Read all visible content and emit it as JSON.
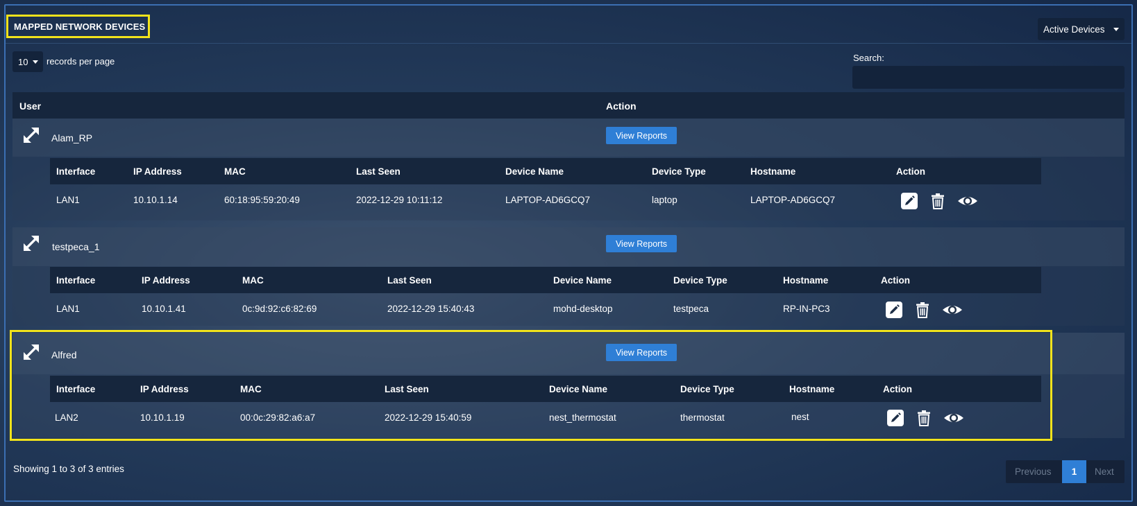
{
  "header": {
    "title": "MAPPED NETWORK DEVICES",
    "filter_value": "Active Devices"
  },
  "controls": {
    "records_per_page": "10",
    "records_label": "records per page",
    "search_label": "Search:",
    "search_value": ""
  },
  "table": {
    "col_user": "User",
    "col_action": "Action",
    "sub_columns": [
      "Interface",
      "IP Address",
      "MAC",
      "Last Seen",
      "Device Name",
      "Device Type",
      "Hostname",
      "Action"
    ],
    "view_reports_label": "View Reports",
    "groups": [
      {
        "user": "Alam_RP",
        "device": {
          "interface": "LAN1",
          "ip": "10.10.1.14",
          "mac": "60:18:95:59:20:49",
          "last_seen": "2022-12-29 10:11:12",
          "device_name": "LAPTOP-AD6GCQ7",
          "device_type": "laptop",
          "hostname": "LAPTOP-AD6GCQ7"
        }
      },
      {
        "user": "testpeca_1",
        "device": {
          "interface": "LAN1",
          "ip": "10.10.1.41",
          "mac": "0c:9d:92:c6:82:69",
          "last_seen": "2022-12-29 15:40:43",
          "device_name": "mohd-desktop",
          "device_type": "testpeca",
          "hostname": "RP-IN-PC3"
        }
      },
      {
        "user": "Alfred",
        "device": {
          "interface": "LAN2",
          "ip": "10.10.1.19",
          "mac": "00:0c:29:82:a6:a7",
          "last_seen": "2022-12-29 15:40:59",
          "device_name": "nest_thermostat",
          "device_type": "thermostat",
          "hostname": "nest"
        }
      }
    ]
  },
  "footer": {
    "info": "Showing 1 to 3 of 3 entries",
    "previous": "Previous",
    "current_page": "1",
    "next": "Next"
  },
  "icons": {
    "expand": "expand-arrows-icon",
    "edit": "pencil-edit-icon",
    "delete": "trash-icon",
    "view": "eye-icon"
  },
  "colors": {
    "accent": "#2f7fd6",
    "highlight": "#f2e31b"
  }
}
